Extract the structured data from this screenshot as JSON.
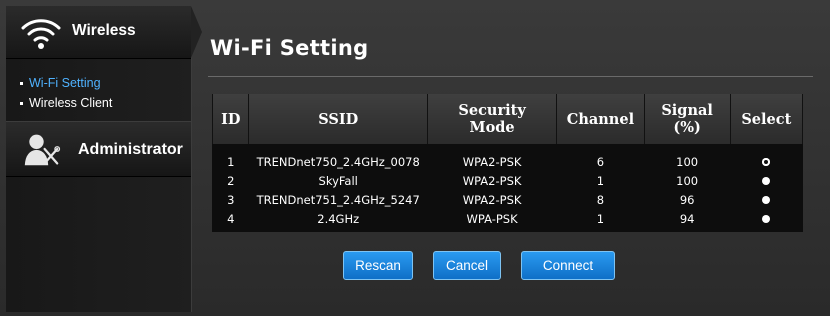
{
  "sidebar": {
    "wireless": {
      "title": "Wireless",
      "icon": "wifi-icon"
    },
    "links": [
      {
        "label": "Wi-Fi Setting",
        "active": true
      },
      {
        "label": "Wireless Client",
        "active": false
      }
    ],
    "administrator": {
      "title": "Administrator",
      "icon": "administrator-tools-icon"
    }
  },
  "main": {
    "title": "Wi-Fi Setting",
    "table": {
      "headers": [
        "ID",
        "SSID",
        "Security Mode",
        "Channel",
        "Signal (%)",
        "Select"
      ],
      "rows": [
        {
          "id": "1",
          "ssid": "TRENDnet750_2.4GHz_0078",
          "security": "WPA2-PSK",
          "channel": "6",
          "signal": "100",
          "selected": true
        },
        {
          "id": "2",
          "ssid": "SkyFall",
          "security": "WPA2-PSK",
          "channel": "1",
          "signal": "100",
          "selected": false
        },
        {
          "id": "3",
          "ssid": "TRENDnet751_2.4GHz_5247",
          "security": "WPA2-PSK",
          "channel": "8",
          "signal": "96",
          "selected": false
        },
        {
          "id": "4",
          "ssid": "2.4GHz",
          "security": "WPA-PSK",
          "channel": "1",
          "signal": "94",
          "selected": false
        }
      ]
    },
    "buttons": {
      "rescan": "Rescan",
      "cancel": "Cancel",
      "connect": "Connect"
    }
  },
  "colors": {
    "accent_link": "#4fb2ff",
    "button_blue": "#1a84dc",
    "background": "#2a2a2a"
  }
}
